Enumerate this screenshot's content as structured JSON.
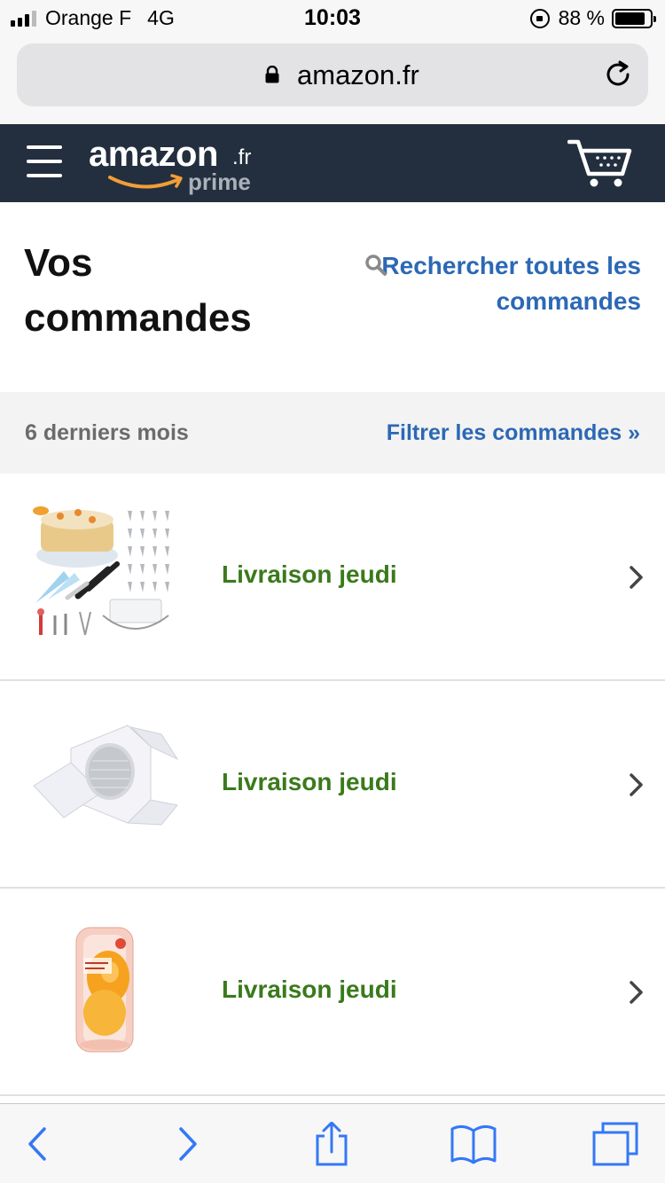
{
  "status_bar": {
    "carrier": "Orange F",
    "network": "4G",
    "time": "10:03",
    "battery": "88 %",
    "battery_level": 0.88,
    "signal_bars_filled": 3,
    "signal_bars_total": 4
  },
  "browser": {
    "url": "amazon.fr",
    "icons": {
      "lock": "lock-icon",
      "reload": "reload-icon"
    }
  },
  "header": {
    "logo_text": "amazon",
    "logo_tld": ".fr",
    "logo_sub": "prime",
    "background": "#232f3e",
    "icons": {
      "menu": "menu-icon",
      "cart": "cart-icon"
    }
  },
  "page": {
    "title": "Vos commandes",
    "search_link": "Rechercher toutes les commandes",
    "link_color": "#2c68b5"
  },
  "filter": {
    "period": "6 derniers mois",
    "filter_link": "Filtrer les commandes »"
  },
  "orders": [
    {
      "status": "Livraison jeudi",
      "product": "cake decorating set"
    },
    {
      "status": "Livraison jeudi",
      "product": "cake box"
    },
    {
      "status": "Livraison jeudi",
      "product": "makeup sponges"
    }
  ],
  "toolbar": {
    "icons": [
      "back-icon",
      "forward-icon",
      "share-icon",
      "bookmarks-icon",
      "tabs-icon"
    ]
  },
  "status_color": "#3a7a1c"
}
